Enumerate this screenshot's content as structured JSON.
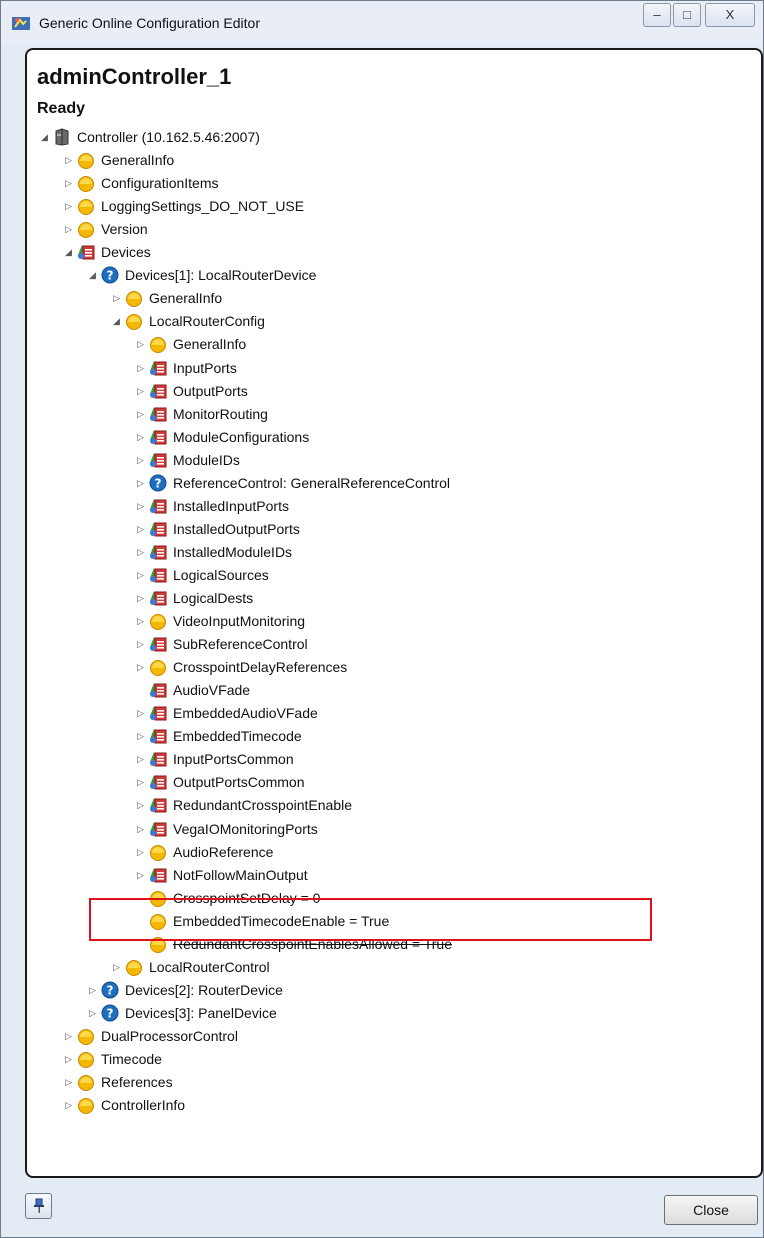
{
  "window": {
    "title": "Generic Online Configuration Editor",
    "controls": {
      "minimize": "–",
      "maximize": "□",
      "close": "X"
    }
  },
  "header": {
    "title": "adminController_1",
    "status": "Ready"
  },
  "tree": [
    {
      "label": "Controller (10.162.5.46:2007)",
      "icon": "controller-icon",
      "expander": "expanded",
      "level": 0
    },
    {
      "label": "GeneralInfo",
      "icon": "folder-icon",
      "expander": "collapsed",
      "level": 1
    },
    {
      "label": "ConfigurationItems",
      "icon": "folder-icon",
      "expander": "collapsed",
      "level": 1
    },
    {
      "label": "LoggingSettings_DO_NOT_USE",
      "icon": "folder-icon",
      "expander": "collapsed",
      "level": 1
    },
    {
      "label": "Version",
      "icon": "folder-icon",
      "expander": "collapsed",
      "level": 1
    },
    {
      "label": "Devices",
      "icon": "list-icon",
      "expander": "expanded",
      "level": 1
    },
    {
      "label": "Devices[1]: LocalRouterDevice",
      "icon": "help-icon",
      "expander": "expanded",
      "level": 2
    },
    {
      "label": "GeneralInfo",
      "icon": "folder-icon",
      "expander": "collapsed",
      "level": 3
    },
    {
      "label": "LocalRouterConfig",
      "icon": "folder-icon",
      "expander": "expanded",
      "level": 3
    },
    {
      "label": "GeneralInfo",
      "icon": "folder-icon",
      "expander": "collapsed",
      "level": 4
    },
    {
      "label": "InputPorts",
      "icon": "list-icon",
      "expander": "collapsed",
      "level": 4
    },
    {
      "label": "OutputPorts",
      "icon": "list-icon",
      "expander": "collapsed",
      "level": 4
    },
    {
      "label": "MonitorRouting",
      "icon": "list-icon",
      "expander": "collapsed",
      "level": 4
    },
    {
      "label": "ModuleConfigurations",
      "icon": "list-icon",
      "expander": "collapsed",
      "level": 4
    },
    {
      "label": "ModuleIDs",
      "icon": "list-icon",
      "expander": "collapsed",
      "level": 4
    },
    {
      "label": "ReferenceControl: GeneralReferenceControl",
      "icon": "help-icon",
      "expander": "collapsed",
      "level": 4
    },
    {
      "label": "InstalledInputPorts",
      "icon": "list-icon",
      "expander": "collapsed",
      "level": 4
    },
    {
      "label": "InstalledOutputPorts",
      "icon": "list-icon",
      "expander": "collapsed",
      "level": 4
    },
    {
      "label": "InstalledModuleIDs",
      "icon": "list-icon",
      "expander": "collapsed",
      "level": 4
    },
    {
      "label": "LogicalSources",
      "icon": "list-icon",
      "expander": "collapsed",
      "level": 4
    },
    {
      "label": "LogicalDests",
      "icon": "list-icon",
      "expander": "collapsed",
      "level": 4
    },
    {
      "label": "VideoInputMonitoring",
      "icon": "folder-icon",
      "expander": "collapsed",
      "level": 4
    },
    {
      "label": "SubReferenceControl",
      "icon": "list-icon",
      "expander": "collapsed",
      "level": 4
    },
    {
      "label": "CrosspointDelayReferences",
      "icon": "folder-icon",
      "expander": "collapsed",
      "level": 4
    },
    {
      "label": "AudioVFade",
      "icon": "list-icon",
      "expander": "none",
      "level": 4
    },
    {
      "label": "EmbeddedAudioVFade",
      "icon": "list-icon",
      "expander": "collapsed",
      "level": 4
    },
    {
      "label": "EmbeddedTimecode",
      "icon": "list-icon",
      "expander": "collapsed",
      "level": 4
    },
    {
      "label": "InputPortsCommon",
      "icon": "list-icon",
      "expander": "collapsed",
      "level": 4
    },
    {
      "label": "OutputPortsCommon",
      "icon": "list-icon",
      "expander": "collapsed",
      "level": 4
    },
    {
      "label": "RedundantCrosspointEnable",
      "icon": "list-icon",
      "expander": "collapsed",
      "level": 4
    },
    {
      "label": "VegaIOMonitoringPorts",
      "icon": "list-icon",
      "expander": "collapsed",
      "level": 4
    },
    {
      "label": "AudioReference",
      "icon": "folder-icon",
      "expander": "collapsed",
      "level": 4
    },
    {
      "label": "NotFollowMainOutput",
      "icon": "list-icon",
      "expander": "collapsed",
      "level": 4
    },
    {
      "label": "CrosspointSetDelay = 0",
      "icon": "folder-icon",
      "expander": "none",
      "level": 4,
      "strike": true
    },
    {
      "label": "EmbeddedTimecodeEnable = True",
      "icon": "folder-icon",
      "expander": "none",
      "level": 4
    },
    {
      "label": "RedundantCrosspointEnablesAllowed = True",
      "icon": "folder-icon",
      "expander": "none",
      "level": 4,
      "strike": true
    },
    {
      "label": "LocalRouterControl",
      "icon": "folder-icon",
      "expander": "collapsed",
      "level": 3
    },
    {
      "label": "Devices[2]: RouterDevice",
      "icon": "help-icon",
      "expander": "collapsed",
      "level": 2
    },
    {
      "label": "Devices[3]: PanelDevice",
      "icon": "help-icon",
      "expander": "collapsed",
      "level": 2
    },
    {
      "label": "DualProcessorControl",
      "icon": "folder-icon",
      "expander": "collapsed",
      "level": 1
    },
    {
      "label": "Timecode",
      "icon": "folder-icon",
      "expander": "collapsed",
      "level": 1
    },
    {
      "label": "References",
      "icon": "folder-icon",
      "expander": "collapsed",
      "level": 1
    },
    {
      "label": "ControllerInfo",
      "icon": "folder-icon",
      "expander": "collapsed",
      "level": 1
    }
  ],
  "footer": {
    "close_label": "Close"
  },
  "colors": {
    "highlight": "#e0101a",
    "folder": "#f5b800",
    "help": "#1e6fc0"
  }
}
